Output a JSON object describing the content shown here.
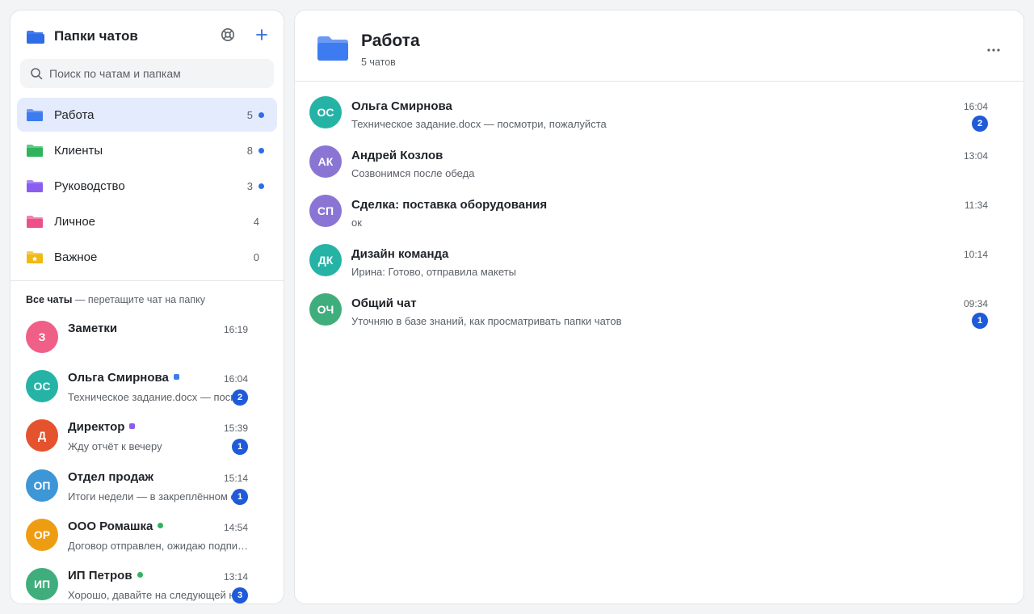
{
  "sidebar": {
    "title": "Папки чатов",
    "search_placeholder": "Поиск по чатам и папкам",
    "folders": [
      {
        "label": "Работа",
        "count": "5",
        "unread": true,
        "color": "#3d7cf0",
        "active": true
      },
      {
        "label": "Клиенты",
        "count": "8",
        "unread": true,
        "color": "#2fb35f",
        "active": false
      },
      {
        "label": "Руководство",
        "count": "3",
        "unread": true,
        "color": "#8a5cf0",
        "active": false
      },
      {
        "label": "Личное",
        "count": "4",
        "unread": false,
        "color": "#ec4f8a",
        "active": false
      },
      {
        "label": "Важное",
        "count": "0",
        "unread": false,
        "color": "#f0b913",
        "active": false
      }
    ],
    "all_chats_label": "Все чаты",
    "all_chats_hint": " — перетащите чат на папку",
    "chats": [
      {
        "initials": "З",
        "name": "Заметки",
        "time": "16:19",
        "preview": "",
        "badge": "",
        "avatar_color": "#ef5f86",
        "tag_color": ""
      },
      {
        "initials": "ОС",
        "name": "Ольга Смирнова",
        "time": "16:04",
        "preview": "Техническое задание.docx — посмотри, пожалуйста",
        "badge": "2",
        "avatar_color": "#25b3a6",
        "tag_color": "#3d7cf0"
      },
      {
        "initials": "Д",
        "name": "Директор",
        "time": "15:39",
        "preview": "Жду отчёт к вечеру",
        "badge": "1",
        "avatar_color": "#e4532e",
        "tag_color": "#8a5cf0"
      },
      {
        "initials": "ОП",
        "name": "Отдел продаж",
        "time": "15:14",
        "preview": "Итоги недели — в закреплённом сообщении",
        "badge": "1",
        "avatar_color": "#3d96d6",
        "tag_color": ""
      },
      {
        "initials": "ОР",
        "name": "ООО Ромашка",
        "time": "14:54",
        "preview": "Договор отправлен, ожидаю подписания",
        "badge": "",
        "avatar_color": "#ee9d12",
        "tag_color": "#2fb35f"
      },
      {
        "initials": "ИП",
        "name": "ИП Петров",
        "time": "13:14",
        "preview": "Хорошо, давайте на следующей неделе",
        "badge": "3",
        "avatar_color": "#3fae7c",
        "tag_color": "#2fb35f"
      }
    ]
  },
  "main": {
    "title": "Работа",
    "subtitle": "5 чатов",
    "chats": [
      {
        "initials": "ОС",
        "name": "Ольга Смирнова",
        "time": "16:04",
        "preview": "Техническое задание.docx — посмотри, пожалуйста",
        "badge": "2",
        "avatar_color": "#25b3a6"
      },
      {
        "initials": "АК",
        "name": "Андрей Козлов",
        "time": "13:04",
        "preview": "Созвонимся после обеда",
        "badge": "",
        "avatar_color": "#8b75d4"
      },
      {
        "initials": "СП",
        "name": "Сделка: поставка оборудования",
        "time": "11:34",
        "preview": "ок",
        "badge": "",
        "avatar_color": "#8b75d4"
      },
      {
        "initials": "ДК",
        "name": "Дизайн команда",
        "time": "10:14",
        "preview": "Ирина: Готово, отправила макеты",
        "badge": "",
        "avatar_color": "#25b3a6"
      },
      {
        "initials": "ОЧ",
        "name": "Общий чат",
        "time": "09:34",
        "preview": "Уточняю в базе знаний, как просматривать папки чатов",
        "badge": "1",
        "avatar_color": "#3fae7c"
      }
    ]
  },
  "icons": {
    "header_folder": "folder-icon",
    "support": "lifebuoy-icon",
    "add": "plus-icon",
    "search": "search-icon",
    "more": "more-horizontal-icon",
    "important_folder": "star-folder-icon"
  },
  "colors": {
    "accent": "#2f6ce5",
    "active_folder_bg": "#e3ebfd",
    "badge": "#1f5bd8"
  }
}
